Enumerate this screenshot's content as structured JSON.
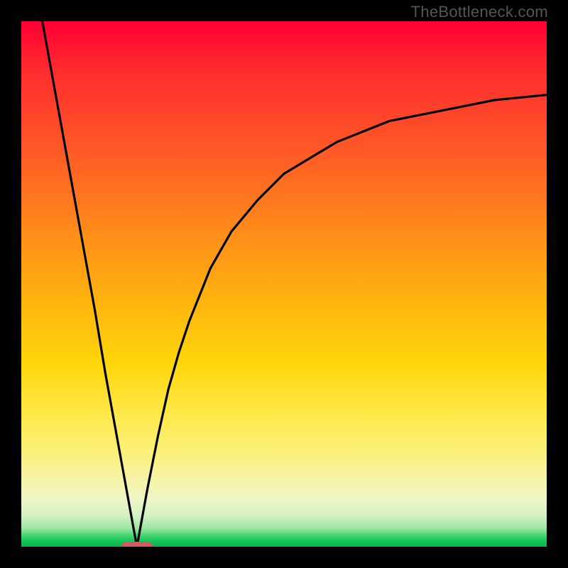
{
  "attribution": "TheBottleneck.com",
  "colors": {
    "frame": "#000000",
    "curve_stroke": "#000000",
    "marker_fill": "#d35a5f",
    "gradient_top": "#ff0033",
    "gradient_bottom": "#0db14b",
    "attribution_text": "#555555"
  },
  "chart_data": {
    "type": "line",
    "title": "",
    "xlabel": "",
    "ylabel": "",
    "xlim": [
      0,
      100
    ],
    "ylim": [
      0,
      100
    ],
    "legend": false,
    "grid": false,
    "background": "vertical red→yellow→green gradient",
    "curve_description": "Sharp V-shaped minimum near x≈22 reaching y≈0, with a steep near-linear left arm rising to y≈100 at x≈4, and a concave right arm asymptotically approaching y≈86 at x=100",
    "x": [
      4,
      6,
      8,
      10,
      12,
      14,
      16,
      18,
      20,
      22,
      24,
      26,
      28,
      30,
      32,
      36,
      40,
      45,
      50,
      55,
      60,
      65,
      70,
      75,
      80,
      85,
      90,
      95,
      100
    ],
    "y": [
      100,
      89,
      78,
      67,
      56,
      45,
      33,
      22,
      11,
      0,
      11,
      21,
      30,
      37,
      43,
      53,
      60,
      66,
      71,
      74,
      77,
      79,
      81,
      82,
      83,
      84,
      85,
      85.5,
      86
    ],
    "marker": {
      "shape": "pill",
      "x": 22,
      "y": 0,
      "width_x_units": 6,
      "height_y_units": 2
    }
  }
}
